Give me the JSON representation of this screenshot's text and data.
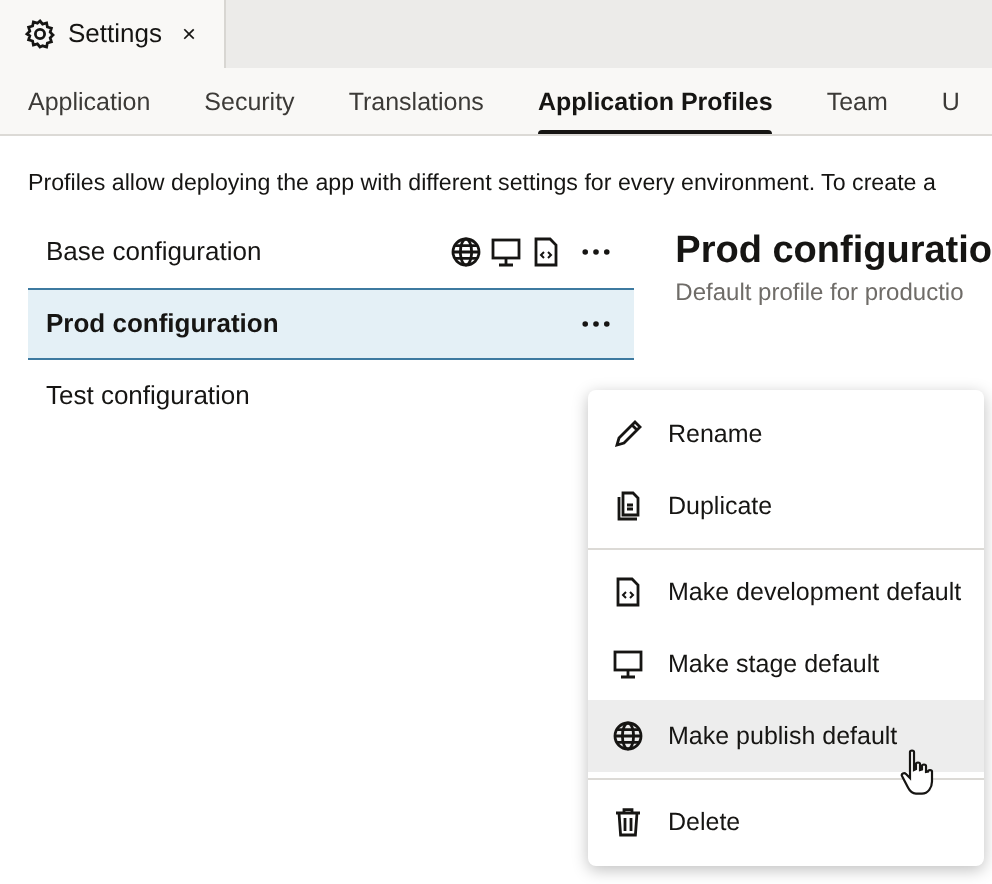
{
  "doc_tabs": [
    {
      "label": "Settings",
      "close": "×",
      "selected": true
    }
  ],
  "tabs": [
    {
      "label": "Application",
      "selected": false
    },
    {
      "label": "Security",
      "selected": false
    },
    {
      "label": "Translations",
      "selected": false
    },
    {
      "label": "Application Profiles",
      "selected": true
    },
    {
      "label": "Team",
      "selected": false
    },
    {
      "label": "U",
      "selected": false
    }
  ],
  "description": "Profiles allow deploying the app with different settings for every environment. To create a",
  "profiles": [
    {
      "name": "Base configuration",
      "selected": false,
      "publish_default": true,
      "stage_default": true,
      "development_default": true,
      "more_button": true
    },
    {
      "name": "Prod configuration",
      "selected": true,
      "publish_default": false,
      "stage_default": false,
      "development_default": false,
      "more_button": true
    },
    {
      "name": "Test configuration",
      "selected": false,
      "publish_default": false,
      "stage_default": false,
      "development_default": false,
      "more_button": false
    }
  ],
  "detail": {
    "title": "Prod configuratio",
    "subtitle": "Default profile for productio"
  },
  "menu": {
    "groups": [
      [
        {
          "label": "Rename",
          "highlighted": false
        },
        {
          "label": "Duplicate",
          "highlighted": false
        }
      ],
      [
        {
          "label": "Make development default",
          "highlighted": false
        },
        {
          "label": "Make stage default",
          "highlighted": false
        },
        {
          "label": "Make publish default",
          "highlighted": true
        }
      ],
      [
        {
          "label": "Delete",
          "highlighted": false
        }
      ]
    ]
  }
}
